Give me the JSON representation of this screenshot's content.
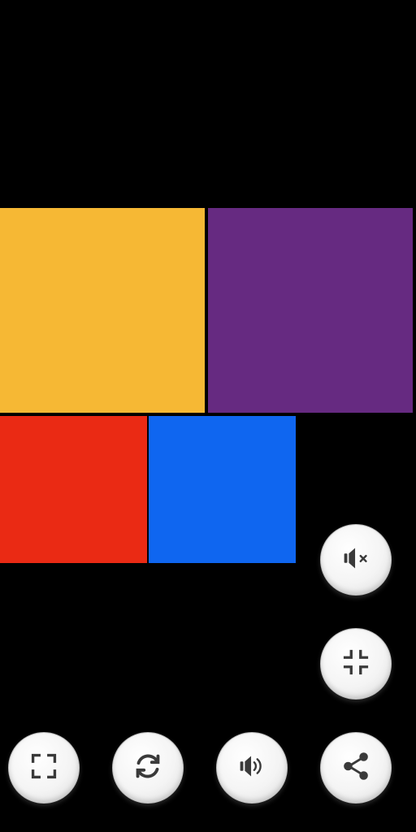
{
  "tiles": [
    {
      "id": "yellow",
      "color": "#F6B834"
    },
    {
      "id": "purple",
      "color": "#662A81"
    },
    {
      "id": "red",
      "color": "#EA2A14"
    },
    {
      "id": "blue",
      "color": "#0F66F0"
    }
  ],
  "controls": {
    "mute": {
      "icon": "volume-mute-icon"
    },
    "exit_fullscreen": {
      "icon": "exit-fullscreen-icon"
    },
    "fullscreen": {
      "icon": "fullscreen-icon"
    },
    "restart": {
      "icon": "refresh-icon"
    },
    "sound": {
      "icon": "volume-icon"
    },
    "share": {
      "icon": "share-icon"
    }
  },
  "icon_color": "#3A3A3A"
}
